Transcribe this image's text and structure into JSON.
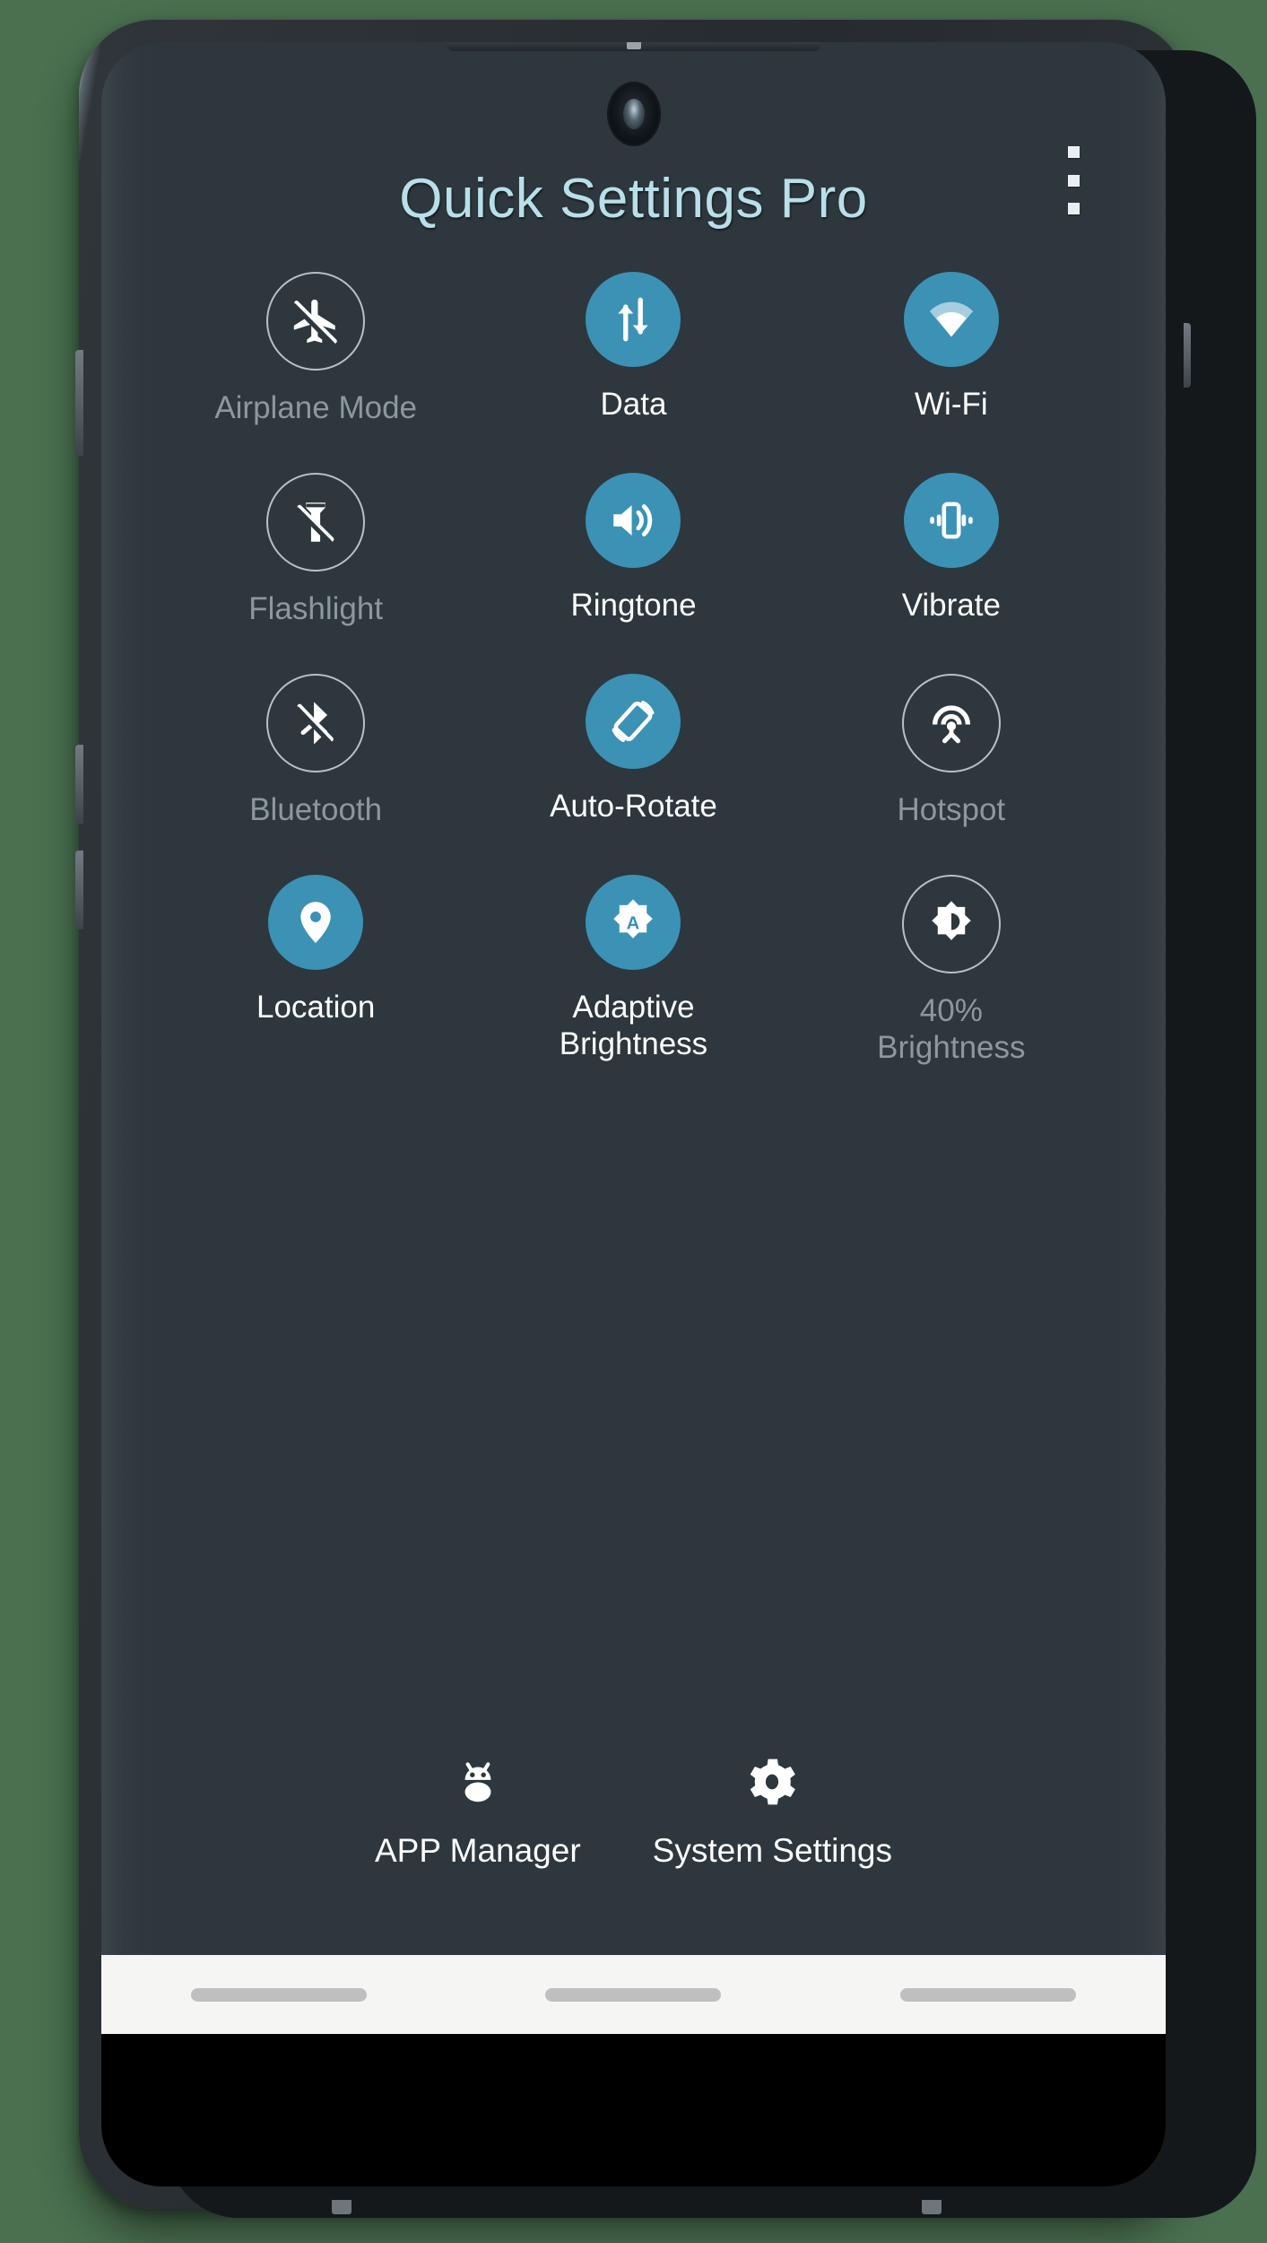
{
  "background_color": "#4a7050",
  "app": {
    "title": "Quick Settings Pro",
    "title_color": "#b9dfe9",
    "screen_background": "#2d373d",
    "accent_on_color": "#3b92b5",
    "label_on_color": "#ffffff",
    "label_off_color": "#8e979c",
    "overflow_menu": "overflow-menu-icon"
  },
  "tiles": [
    {
      "id": "airplane-mode",
      "label": "Airplane Mode",
      "state": "off",
      "icon": "airplane-off-icon"
    },
    {
      "id": "data",
      "label": "Data",
      "state": "on",
      "icon": "data-transfer-icon"
    },
    {
      "id": "wifi",
      "label": "Wi-Fi",
      "state": "on",
      "icon": "wifi-icon"
    },
    {
      "id": "flashlight",
      "label": "Flashlight",
      "state": "off",
      "icon": "flashlight-off-icon"
    },
    {
      "id": "ringtone",
      "label": "Ringtone",
      "state": "on",
      "icon": "volume-up-icon"
    },
    {
      "id": "vibrate",
      "label": "Vibrate",
      "state": "on",
      "icon": "vibration-icon"
    },
    {
      "id": "bluetooth",
      "label": "Bluetooth",
      "state": "off",
      "icon": "bluetooth-off-icon"
    },
    {
      "id": "auto-rotate",
      "label": "Auto-Rotate",
      "state": "on",
      "icon": "screen-rotation-icon"
    },
    {
      "id": "hotspot",
      "label": "Hotspot",
      "state": "off",
      "icon": "hotspot-icon"
    },
    {
      "id": "location",
      "label": "Location",
      "state": "on",
      "icon": "location-pin-icon"
    },
    {
      "id": "adaptive-brightness",
      "label": "Adaptive\nBrightness",
      "state": "on",
      "icon": "brightness-auto-icon"
    },
    {
      "id": "brightness",
      "label": "40%\nBrightness",
      "state": "off",
      "icon": "brightness-medium-icon",
      "value": "40%"
    }
  ],
  "actions": [
    {
      "id": "app-manager",
      "label": "APP Manager",
      "icon": "android-bug-icon"
    },
    {
      "id": "system-settings",
      "label": "System Settings",
      "icon": "gear-icon"
    }
  ],
  "nav_bar": {
    "pills": [
      "recents-pill",
      "home-pill",
      "back-pill"
    ]
  }
}
